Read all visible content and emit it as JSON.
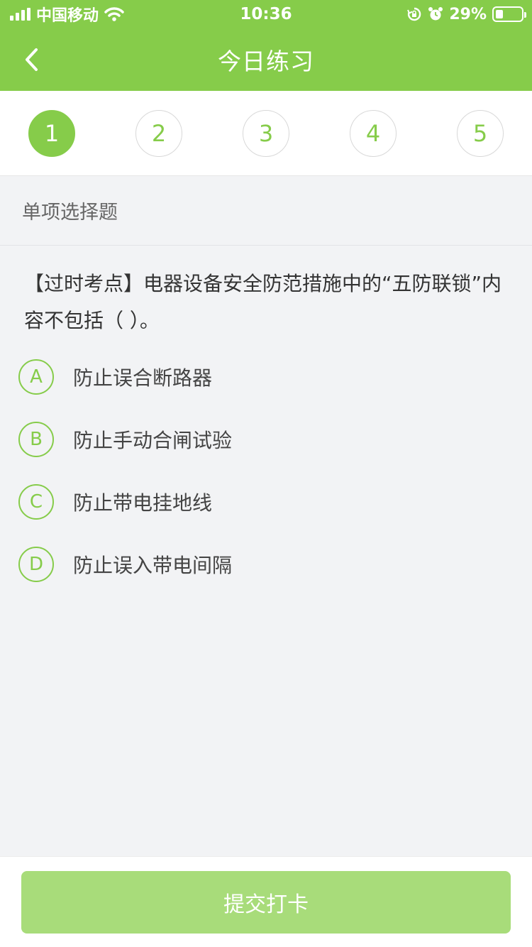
{
  "status_bar": {
    "carrier": "中国移动",
    "time": "10:36",
    "battery_percent": "29%",
    "battery_level": 0.29,
    "icons": [
      "signal-icon",
      "wifi-icon",
      "orientation-lock-icon",
      "alarm-icon",
      "battery-icon"
    ]
  },
  "nav": {
    "title": "今日练习",
    "back_icon": "chevron-left-icon"
  },
  "steps": [
    {
      "label": "1",
      "active": true
    },
    {
      "label": "2",
      "active": false
    },
    {
      "label": "3",
      "active": false
    },
    {
      "label": "4",
      "active": false
    },
    {
      "label": "5",
      "active": false
    }
  ],
  "question": {
    "type": "单项选择题",
    "text": "【过时考点】电器设备安全防范措施中的“五防联锁”内容不包括（    ）。",
    "options": [
      {
        "letter": "A",
        "text": "防止误合断路器"
      },
      {
        "letter": "B",
        "text": "防止手动合闸试验"
      },
      {
        "letter": "C",
        "text": "防止带电挂地线"
      },
      {
        "letter": "D",
        "text": "防止误入带电间隔"
      }
    ]
  },
  "footer": {
    "submit_label": "提交打卡"
  },
  "colors": {
    "accent": "#86cc4a",
    "button_disabled": "#a8dc7a",
    "background": "#f2f3f5"
  }
}
